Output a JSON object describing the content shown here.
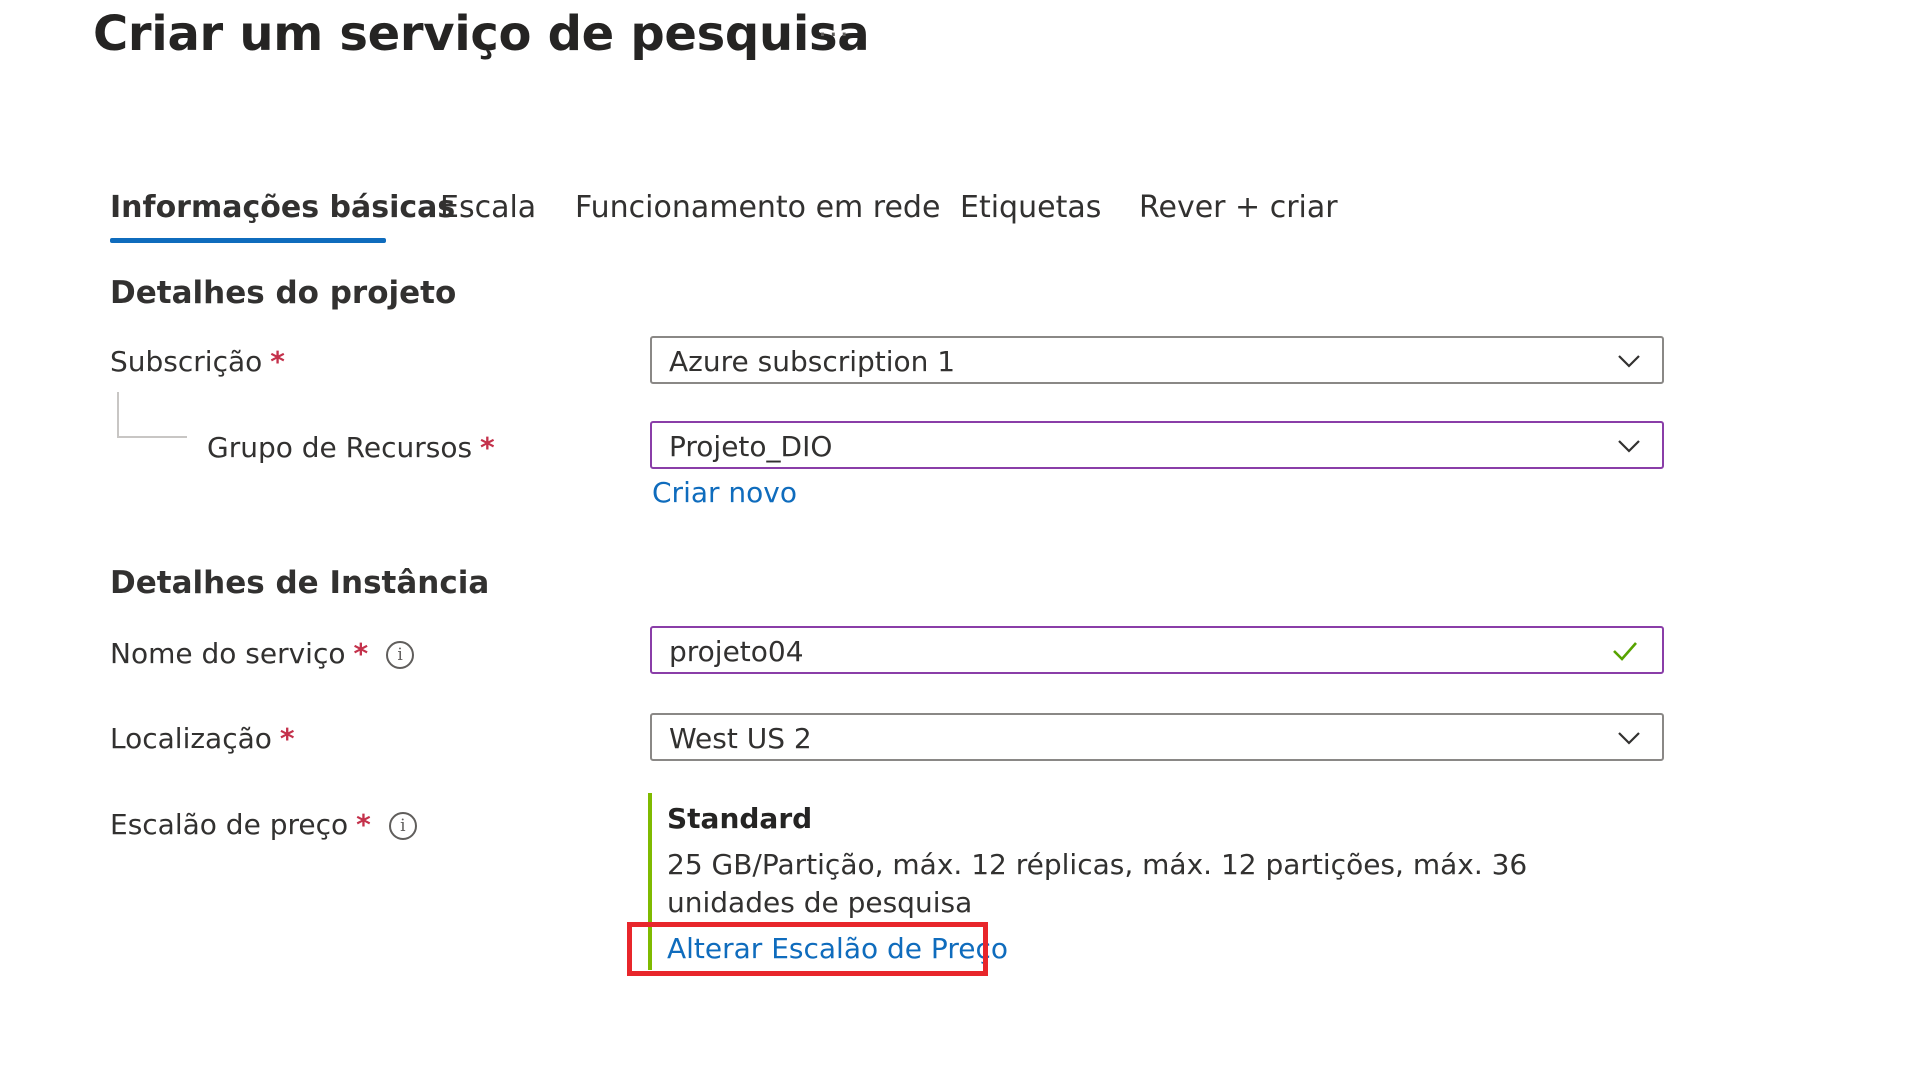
{
  "header": {
    "title": "Criar um serviço de pesquisa",
    "more_label": "···"
  },
  "tabs": [
    {
      "label": "Informações básicas",
      "active": true
    },
    {
      "label": "Escala",
      "active": false
    },
    {
      "label": "Funcionamento em rede",
      "active": false
    },
    {
      "label": "Etiquetas",
      "active": false
    },
    {
      "label": "Rever + criar",
      "active": false
    }
  ],
  "project": {
    "heading": "Detalhes do projeto",
    "subscription": {
      "label": "Subscrição",
      "value": "Azure subscription 1"
    },
    "resource_group": {
      "label": "Grupo de Recursos",
      "value": "Projeto_DIO",
      "create_new_label": "Criar novo"
    }
  },
  "instance": {
    "heading": "Detalhes de Instância",
    "service_name": {
      "label": "Nome do serviço",
      "value": "projeto04",
      "valid": true
    },
    "location": {
      "label": "Localização",
      "value": "West US 2"
    },
    "pricing": {
      "label": "Escalão de preço",
      "tier": "Standard",
      "description": "25 GB/Partição, máx. 12 réplicas, máx. 12 partições, máx. 36 unidades de pesquisa",
      "change_label": "Alterar Escalão de Preço"
    }
  },
  "required_marker": "*",
  "info_glyph": "i",
  "colors": {
    "accent": "#0f6cbd",
    "focus_border": "#8a3ea8",
    "required": "#c4314b",
    "valid_check": "#57a300",
    "pricing_bar": "#7fba00",
    "highlight": "#e8262b"
  }
}
